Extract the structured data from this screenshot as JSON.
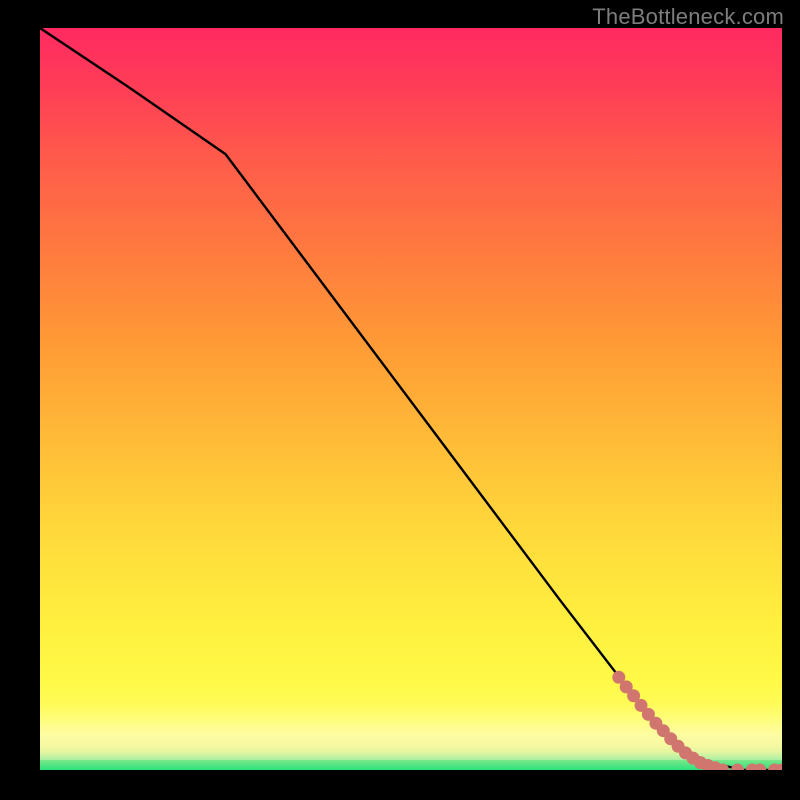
{
  "watermark": "TheBottleneck.com",
  "colors": {
    "background": "#000000",
    "gradient_top": "#ff2a61",
    "gradient_mid_orange": "#ff9936",
    "gradient_mid_yellow": "#fff947",
    "gradient_bottom_green": "#2be27d",
    "curve": "#000000",
    "marker": "#d1766e"
  },
  "chart_data": {
    "type": "line",
    "title": "",
    "xlabel": "",
    "ylabel": "",
    "xlim": [
      0,
      100
    ],
    "ylim": [
      0,
      100
    ],
    "grid": false,
    "legend": false,
    "series": [
      {
        "name": "bottleneck-curve",
        "x": [
          0,
          12,
          25,
          40,
          55,
          70,
          80,
          85,
          90,
          95,
          100
        ],
        "y": [
          100,
          92,
          83,
          63,
          43,
          23,
          10,
          4,
          1,
          0,
          0
        ]
      }
    ],
    "markers": {
      "name": "sample-points",
      "points": [
        {
          "x": 78,
          "y": 12.5
        },
        {
          "x": 79,
          "y": 11.2
        },
        {
          "x": 80,
          "y": 10.0
        },
        {
          "x": 81,
          "y": 8.7
        },
        {
          "x": 82,
          "y": 7.5
        },
        {
          "x": 83,
          "y": 6.3
        },
        {
          "x": 84,
          "y": 5.3
        },
        {
          "x": 85,
          "y": 4.2
        },
        {
          "x": 86,
          "y": 3.2
        },
        {
          "x": 87,
          "y": 2.3
        },
        {
          "x": 88,
          "y": 1.6
        },
        {
          "x": 89,
          "y": 1.0
        },
        {
          "x": 90,
          "y": 0.6
        },
        {
          "x": 91,
          "y": 0.3
        },
        {
          "x": 92,
          "y": 0.0
        },
        {
          "x": 94,
          "y": 0.0
        },
        {
          "x": 96,
          "y": 0.0
        },
        {
          "x": 97,
          "y": 0.0
        },
        {
          "x": 99,
          "y": 0.0
        },
        {
          "x": 100,
          "y": 0.0
        }
      ]
    },
    "annotations": []
  }
}
